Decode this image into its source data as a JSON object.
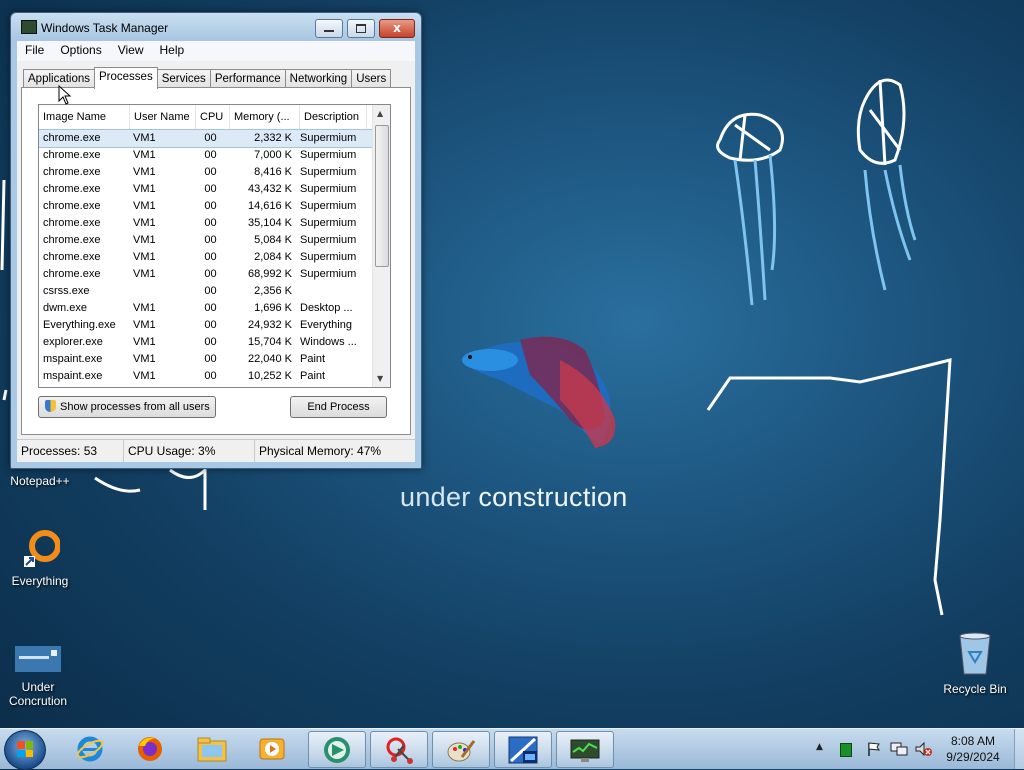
{
  "wallpaper": {
    "text_1": "under",
    "text_2": "construction"
  },
  "desktop_icons": {
    "notepadpp": "Notepad++",
    "everything": "Everything",
    "under_concrution_l1": "Under",
    "under_concrution_l2": "Concrution",
    "recycle_bin": "Recycle Bin"
  },
  "window": {
    "title": "Windows Task Manager",
    "close_glyph": "x",
    "menu": [
      "File",
      "Options",
      "View",
      "Help"
    ],
    "tabs": [
      "Applications",
      "Processes",
      "Services",
      "Performance",
      "Networking",
      "Users"
    ],
    "active_tab": "Processes",
    "columns": [
      "Image Name",
      "User Name",
      "CPU",
      "Memory (...",
      "Description"
    ],
    "rows": [
      {
        "name": "chrome.exe",
        "user": "VM1",
        "cpu": "00",
        "mem": "2,332 K",
        "desc": "Supermium"
      },
      {
        "name": "chrome.exe",
        "user": "VM1",
        "cpu": "00",
        "mem": "7,000 K",
        "desc": "Supermium"
      },
      {
        "name": "chrome.exe",
        "user": "VM1",
        "cpu": "00",
        "mem": "8,416 K",
        "desc": "Supermium"
      },
      {
        "name": "chrome.exe",
        "user": "VM1",
        "cpu": "00",
        "mem": "43,432 K",
        "desc": "Supermium"
      },
      {
        "name": "chrome.exe",
        "user": "VM1",
        "cpu": "00",
        "mem": "14,616 K",
        "desc": "Supermium"
      },
      {
        "name": "chrome.exe",
        "user": "VM1",
        "cpu": "00",
        "mem": "35,104 K",
        "desc": "Supermium"
      },
      {
        "name": "chrome.exe",
        "user": "VM1",
        "cpu": "00",
        "mem": "5,084 K",
        "desc": "Supermium"
      },
      {
        "name": "chrome.exe",
        "user": "VM1",
        "cpu": "00",
        "mem": "2,084 K",
        "desc": "Supermium"
      },
      {
        "name": "chrome.exe",
        "user": "VM1",
        "cpu": "00",
        "mem": "68,992 K",
        "desc": "Supermium"
      },
      {
        "name": "csrss.exe",
        "user": "",
        "cpu": "00",
        "mem": "2,356 K",
        "desc": ""
      },
      {
        "name": "dwm.exe",
        "user": "VM1",
        "cpu": "00",
        "mem": "1,696 K",
        "desc": "Desktop ..."
      },
      {
        "name": "Everything.exe",
        "user": "VM1",
        "cpu": "00",
        "mem": "24,932 K",
        "desc": "Everything"
      },
      {
        "name": "explorer.exe",
        "user": "VM1",
        "cpu": "00",
        "mem": "15,704 K",
        "desc": "Windows ..."
      },
      {
        "name": "mspaint.exe",
        "user": "VM1",
        "cpu": "00",
        "mem": "22,040 K",
        "desc": "Paint"
      },
      {
        "name": "mspaint.exe",
        "user": "VM1",
        "cpu": "00",
        "mem": "10,252 K",
        "desc": "Paint"
      }
    ],
    "selected_row": 0,
    "show_all_label": "Show processes from all users",
    "end_process_label": "End Process",
    "status": {
      "processes": "Processes: 53",
      "cpu": "CPU Usage: 3%",
      "memory": "Physical Memory: 47%"
    }
  },
  "taskbar": {
    "pinned": [
      "internet-explorer-icon",
      "firefox-icon",
      "explorer-folder-icon",
      "media-player-icon"
    ],
    "running": [
      "teamviewer-icon",
      "snipping-tool-icon",
      "paint-icon",
      "xp-mode-icon",
      "task-manager-icon"
    ],
    "tray_icons": [
      "show-hidden-icons-arrow",
      "green-app-icon",
      "action-center-flag-icon",
      "network-icon",
      "volume-muted-icon"
    ],
    "time": "8:08 AM",
    "date": "9/29/2024"
  },
  "colors": {
    "desktop_bg": "#164a72",
    "doodle": "#ffffff",
    "jellyfish": "#7fc3f0",
    "title_bg": "#a9c8e3"
  }
}
